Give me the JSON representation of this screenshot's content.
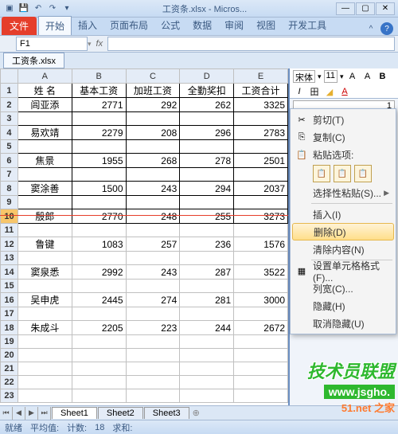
{
  "window": {
    "title": "工资条.xlsx - Micros...",
    "doc_tab": "工资条.xlsx"
  },
  "ribbon": {
    "file": "文件",
    "tabs": [
      "开始",
      "插入",
      "页面布局",
      "公式",
      "数据",
      "审阅",
      "视图",
      "开发工具"
    ]
  },
  "namebox": "F1",
  "fx": "fx",
  "columns": [
    "A",
    "B",
    "C",
    "D",
    "E"
  ],
  "headers": [
    "姓 名",
    "基本工资",
    "加班工资",
    "全勤奖扣",
    "工资合计"
  ],
  "rows": [
    {
      "r": 1,
      "type": "header"
    },
    {
      "r": 2,
      "type": "data",
      "name": "闾亚添",
      "v": [
        2771,
        292,
        262,
        3325
      ]
    },
    {
      "r": 3,
      "type": "blank"
    },
    {
      "r": 4,
      "type": "data",
      "name": "易欢靖",
      "v": [
        2279,
        208,
        296,
        2783
      ]
    },
    {
      "r": 5,
      "type": "blank"
    },
    {
      "r": 6,
      "type": "data",
      "name": "焦景",
      "v": [
        1955,
        268,
        278,
        2501
      ]
    },
    {
      "r": 7,
      "type": "blank"
    },
    {
      "r": 8,
      "type": "data",
      "name": "窦涂善",
      "v": [
        1500,
        243,
        294,
        2037
      ]
    },
    {
      "r": 9,
      "type": "blank"
    },
    {
      "r": 10,
      "type": "data",
      "name": "殷郎",
      "v": [
        2770,
        248,
        255,
        3273
      ],
      "selected": true
    },
    {
      "r": 11,
      "type": "empty"
    },
    {
      "r": 12,
      "type": "plain",
      "name": "鲁键",
      "v": [
        1083,
        257,
        236,
        1576
      ]
    },
    {
      "r": 13,
      "type": "empty"
    },
    {
      "r": 14,
      "type": "plain",
      "name": "窦泉悉",
      "v": [
        2992,
        243,
        287,
        3522
      ]
    },
    {
      "r": 15,
      "type": "empty"
    },
    {
      "r": 16,
      "type": "plain",
      "name": "吴申虎",
      "v": [
        2445,
        274,
        281,
        3000
      ]
    },
    {
      "r": 17,
      "type": "empty"
    },
    {
      "r": 18,
      "type": "plain",
      "name": "朱成斗",
      "v": [
        2205,
        223,
        244,
        2672
      ]
    },
    {
      "r": 19,
      "type": "empty"
    },
    {
      "r": 20,
      "type": "empty"
    },
    {
      "r": 21,
      "type": "empty"
    },
    {
      "r": 22,
      "type": "empty"
    },
    {
      "r": 23,
      "type": "empty"
    }
  ],
  "side": {
    "font": "宋体",
    "size": "11",
    "cell_sample": "1"
  },
  "context_menu": [
    {
      "icon": "✂",
      "label": "剪切(T)"
    },
    {
      "icon": "⎘",
      "label": "复制(C)"
    },
    {
      "icon": "📋",
      "label": "粘贴选项:",
      "header": true
    },
    {
      "paste_opts": true
    },
    {
      "label": "选择性粘贴(S)...",
      "sub": true
    },
    {
      "sep": true
    },
    {
      "label": "插入(I)"
    },
    {
      "label": "删除(D)",
      "hover": true
    },
    {
      "label": "清除内容(N)"
    },
    {
      "sep": true
    },
    {
      "icon": "▦",
      "label": "设置单元格格式(F)..."
    },
    {
      "label": "列宽(C)..."
    },
    {
      "label": "隐藏(H)"
    },
    {
      "label": "取消隐藏(U)"
    }
  ],
  "sheets": [
    "Sheet1",
    "Sheet2",
    "Sheet3"
  ],
  "status": {
    "ready": "就绪",
    "avg": "平均值: ",
    "count_label": "计数: ",
    "count": "18",
    "sum": "求和: "
  },
  "watermark": {
    "l1": "技术员联盟",
    "l2": "www.jsgho.",
    "l3": "51.net 之家"
  }
}
